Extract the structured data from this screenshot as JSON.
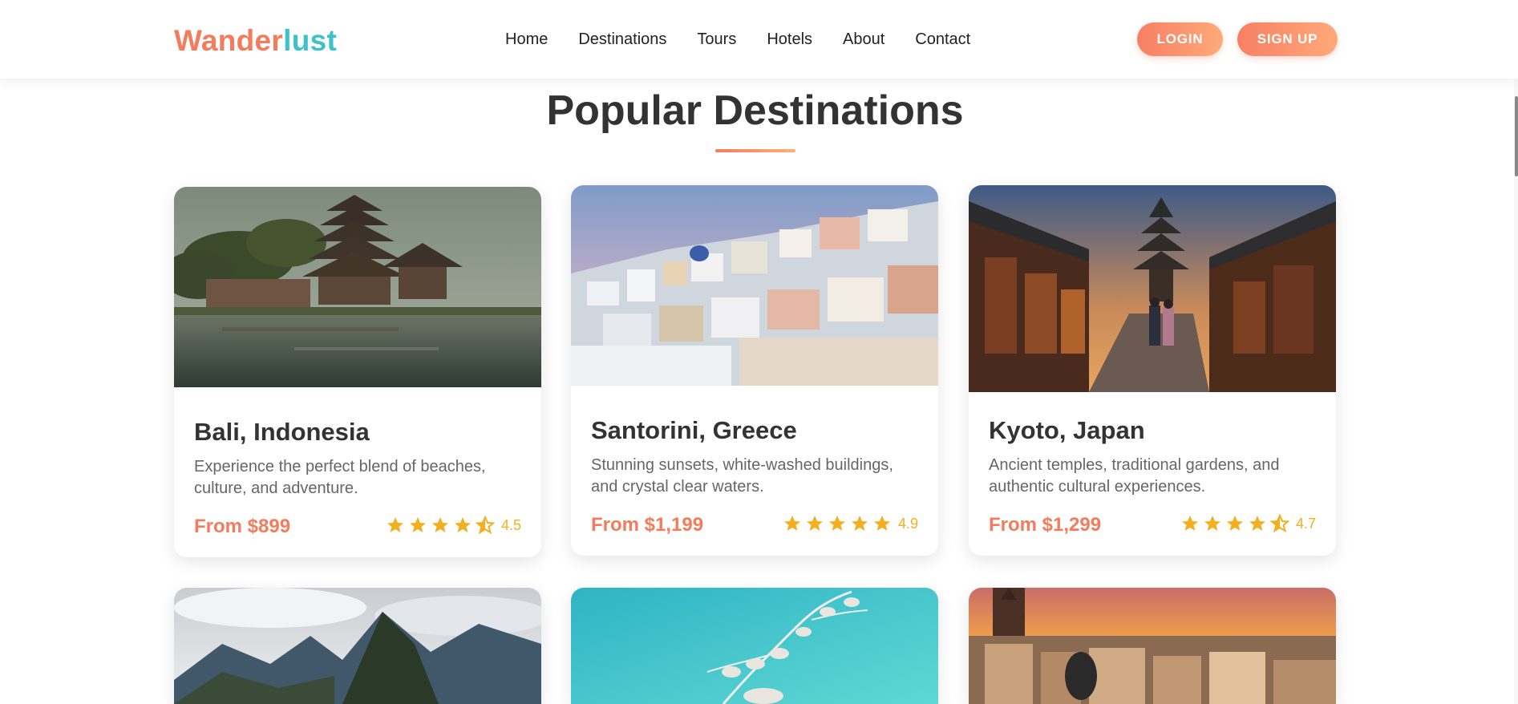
{
  "header": {
    "logo_part1": "Wander",
    "logo_part2": "lust",
    "nav": [
      "Home",
      "Destinations",
      "Tours",
      "Hotels",
      "About",
      "Contact"
    ],
    "login_label": "LOGIN",
    "signup_label": "SIGN UP"
  },
  "section": {
    "title": "Popular Destinations"
  },
  "destinations": [
    {
      "name": "Bali, Indonesia",
      "description": "Experience the perfect blend of beaches, culture, and adventure.",
      "price": "From $899",
      "rating": "4.5",
      "rating_value": 4.5
    },
    {
      "name": "Santorini, Greece",
      "description": "Stunning sunsets, white-washed buildings, and crystal clear waters.",
      "price": "From $1,199",
      "rating": "4.9",
      "rating_value": 5
    },
    {
      "name": "Kyoto, Japan",
      "description": "Ancient temples, traditional gardens, and authentic cultural experiences.",
      "price": "From $1,299",
      "rating": "4.7",
      "rating_value": 4.5
    }
  ],
  "colors": {
    "accent": "#f47c5c",
    "logo_teal": "#3fc1c9",
    "star": "#f2b01e"
  }
}
